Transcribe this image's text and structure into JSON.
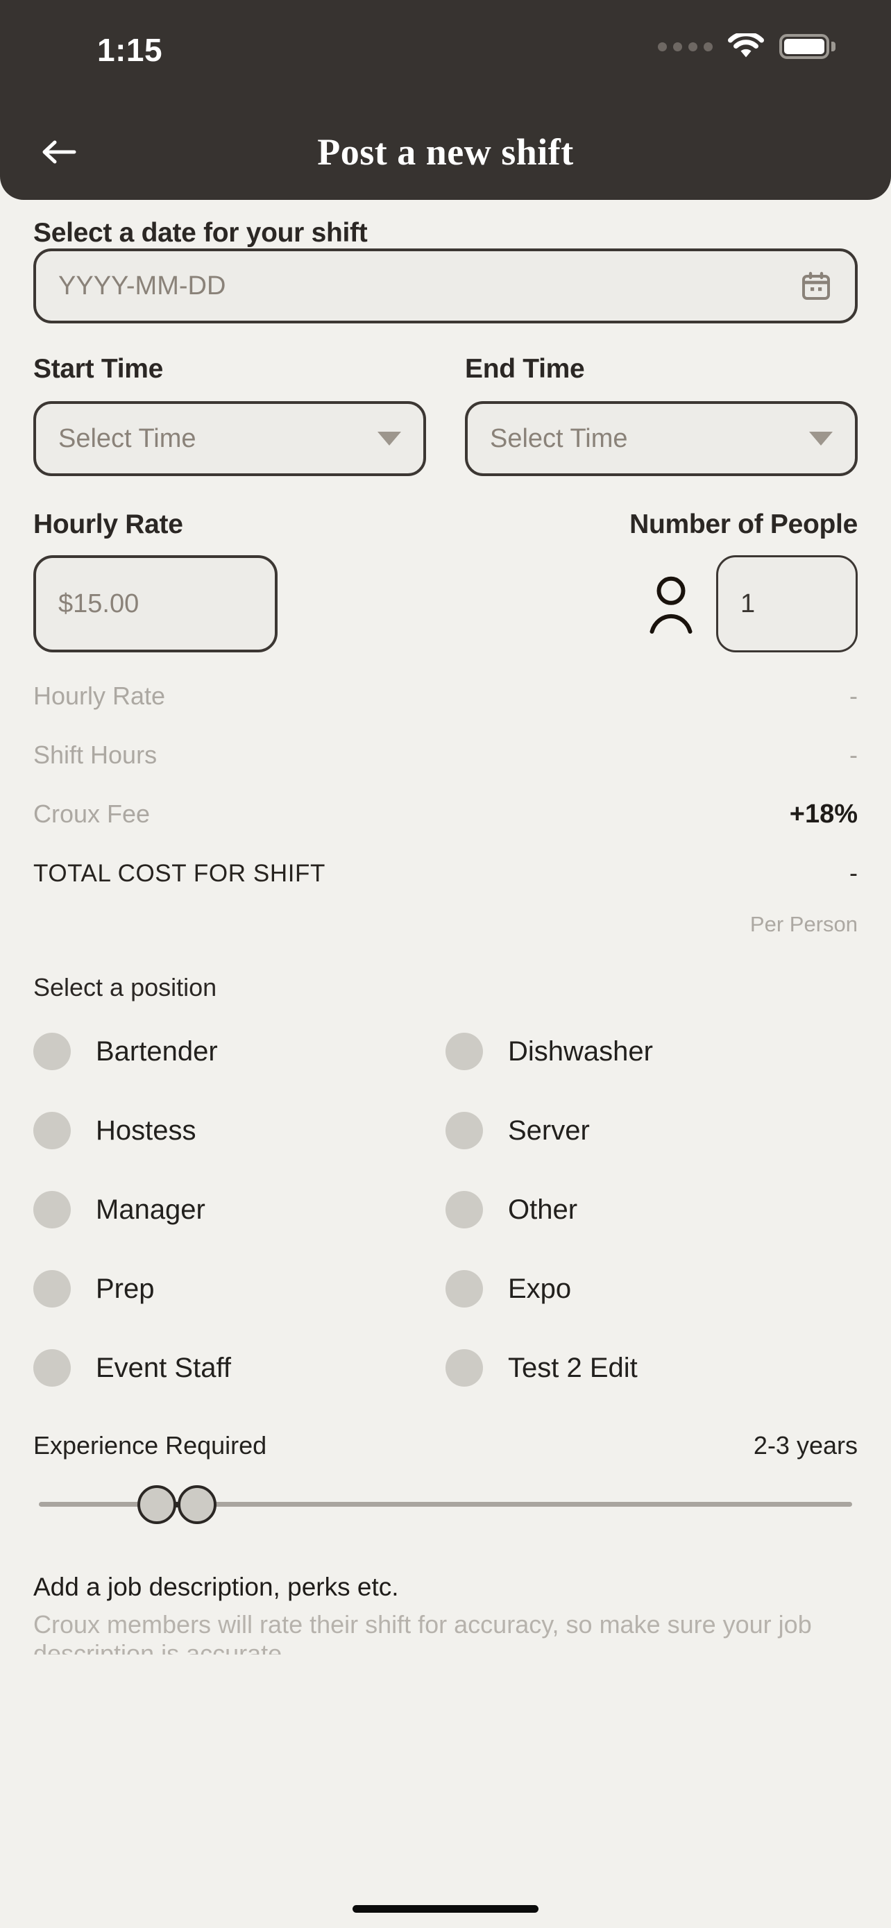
{
  "status_bar": {
    "time": "1:15",
    "signal_icon": "cellular-dots-icon",
    "wifi_icon": "wifi-icon",
    "battery_icon": "battery-full-icon"
  },
  "header": {
    "title": "Post a new shift",
    "back_icon": "arrow-left-icon"
  },
  "date_section": {
    "label": "Select a date for your shift",
    "placeholder": "YYYY-MM-DD",
    "value": "",
    "calendar_icon": "calendar-icon"
  },
  "time_section": {
    "start": {
      "label": "Start Time",
      "placeholder": "Select Time",
      "value": ""
    },
    "end": {
      "label": "End Time",
      "placeholder": "Select Time",
      "value": ""
    },
    "dropdown_icon": "chevron-down-icon"
  },
  "rate_section": {
    "rate_label": "Hourly Rate",
    "rate_placeholder": "$15.00",
    "rate_value": "",
    "people_label": "Number of People",
    "people_value": "1",
    "person_icon": "person-icon"
  },
  "summary": {
    "rows": [
      {
        "label": "Hourly Rate",
        "value": "-"
      },
      {
        "label": "Shift Hours",
        "value": "-"
      },
      {
        "label": "Croux Fee",
        "value": "+18%"
      }
    ],
    "total_label": "TOTAL COST FOR SHIFT",
    "total_value": "-",
    "per_person_note": "Per Person"
  },
  "positions": {
    "title": "Select a position",
    "left_column": [
      {
        "label": "Bartender",
        "selected": false
      },
      {
        "label": "Hostess",
        "selected": false
      },
      {
        "label": "Manager",
        "selected": false
      },
      {
        "label": "Prep",
        "selected": false
      },
      {
        "label": "Event Staff",
        "selected": false
      }
    ],
    "right_column": [
      {
        "label": "Dishwasher",
        "selected": false
      },
      {
        "label": "Server",
        "selected": false
      },
      {
        "label": "Other",
        "selected": false
      },
      {
        "label": "Expo",
        "selected": false
      },
      {
        "label": "Test 2 Edit",
        "selected": false
      }
    ]
  },
  "experience": {
    "label": "Experience Required",
    "value": "2-3 years"
  },
  "description": {
    "title": "Add a job description, perks etc.",
    "hint": "Croux members will rate their shift for accuracy, so make sure your job description is accurate."
  },
  "colors": {
    "header_bg": "#373330",
    "page_bg": "#F2F1ED",
    "field_bg": "#EDECE8",
    "field_border": "#3C3733",
    "placeholder": "#8A8279",
    "muted": "#ACA8A2",
    "radio": "#CDCBC5"
  }
}
